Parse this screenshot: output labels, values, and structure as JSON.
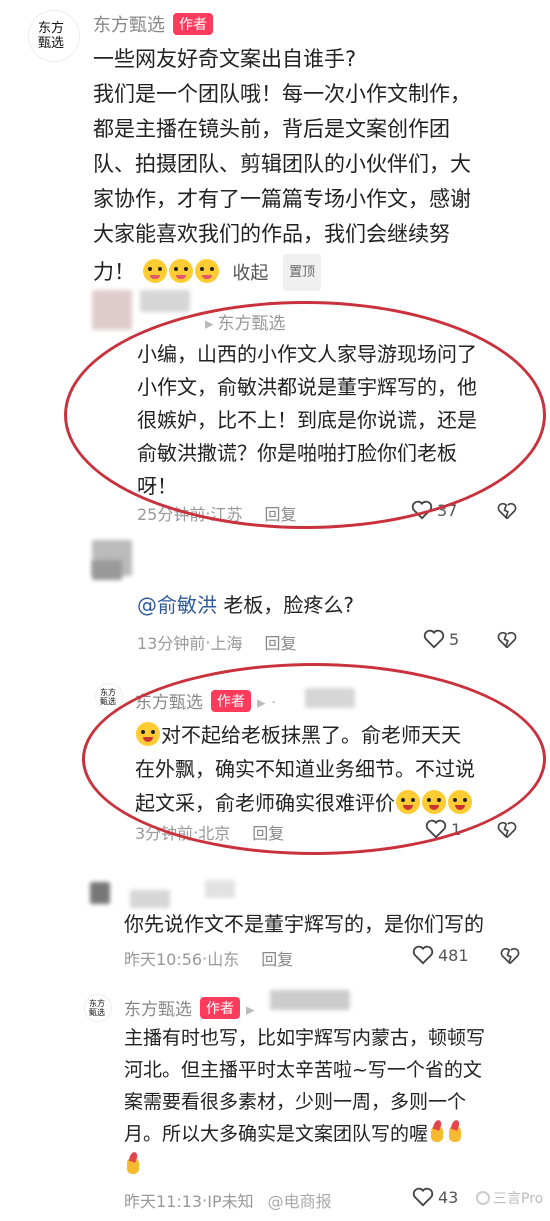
{
  "c1": {
    "avatar": "东方甄选",
    "name": "东方甄选",
    "tag": "作者",
    "lines": [
      "一些网友好奇文案出自谁手?",
      "我们是一个团队哦！每一次小作文制作，",
      "都是主播在镜头前，背后是文案创作团",
      "队、拍摄团队、剪辑团队的小伙伴们，大",
      "家协作，才有了一篇篇专场小作文，感谢",
      "大家能喜欢我们的作品，我们会继续努"
    ],
    "last_line": "力！",
    "collapse": "收起",
    "pin": "置顶"
  },
  "c2": {
    "name": "东方甄选",
    "lines": [
      "小编，山西的小作文人家导游现场问了",
      "小作文，俞敏洪都说是董宇辉写的，他",
      "很嫉妒，比不上！到底是你说谎，还是",
      "俞敏洪撒谎？你是啪啪打脸你们老板",
      "呀！"
    ],
    "time": "25分钟前",
    "location": "江苏",
    "reply": "回复",
    "likes": "37"
  },
  "c3": {
    "mention": "@俞敏洪",
    "text": " 老板，脸疼么?",
    "time": "13分钟前",
    "location": "上海",
    "reply": "回复",
    "likes": "5"
  },
  "c4": {
    "name": "东方甄选",
    "tag": "作者",
    "line1": "对不起给老板抹黑了。俞老师天天",
    "line2": "在外飘，确实不知道业务细节。不过说",
    "line3": "起文采，俞老师确实很难评价",
    "time": "3分钟前",
    "location": "北京",
    "reply": "回复",
    "likes": "1"
  },
  "c5": {
    "text": "你先说作文不是董宇辉写的，是你们写的",
    "time": "昨天10:56",
    "location": "山东",
    "reply": "回复",
    "likes": "481"
  },
  "c6": {
    "name": "东方甄选",
    "tag": "作者",
    "lines": [
      "主播有时也写，比如宇辉写内蒙古，顿顿写",
      "河北。但主播平时太辛苦啦~写一个省的文",
      "案需要看很多素材，少则一周，多则一个"
    ],
    "line4": "月。所以大多确实是文案团队写的喔",
    "time": "昨天11:13",
    "location": "IP未知",
    "likes": "43",
    "watermark": "三言Pro",
    "watermark2": "@电商报"
  },
  "sep": " · ",
  "colors": {
    "accent": "#ff3b5c",
    "circle": "#c9323d",
    "link": "#2f5a99"
  }
}
